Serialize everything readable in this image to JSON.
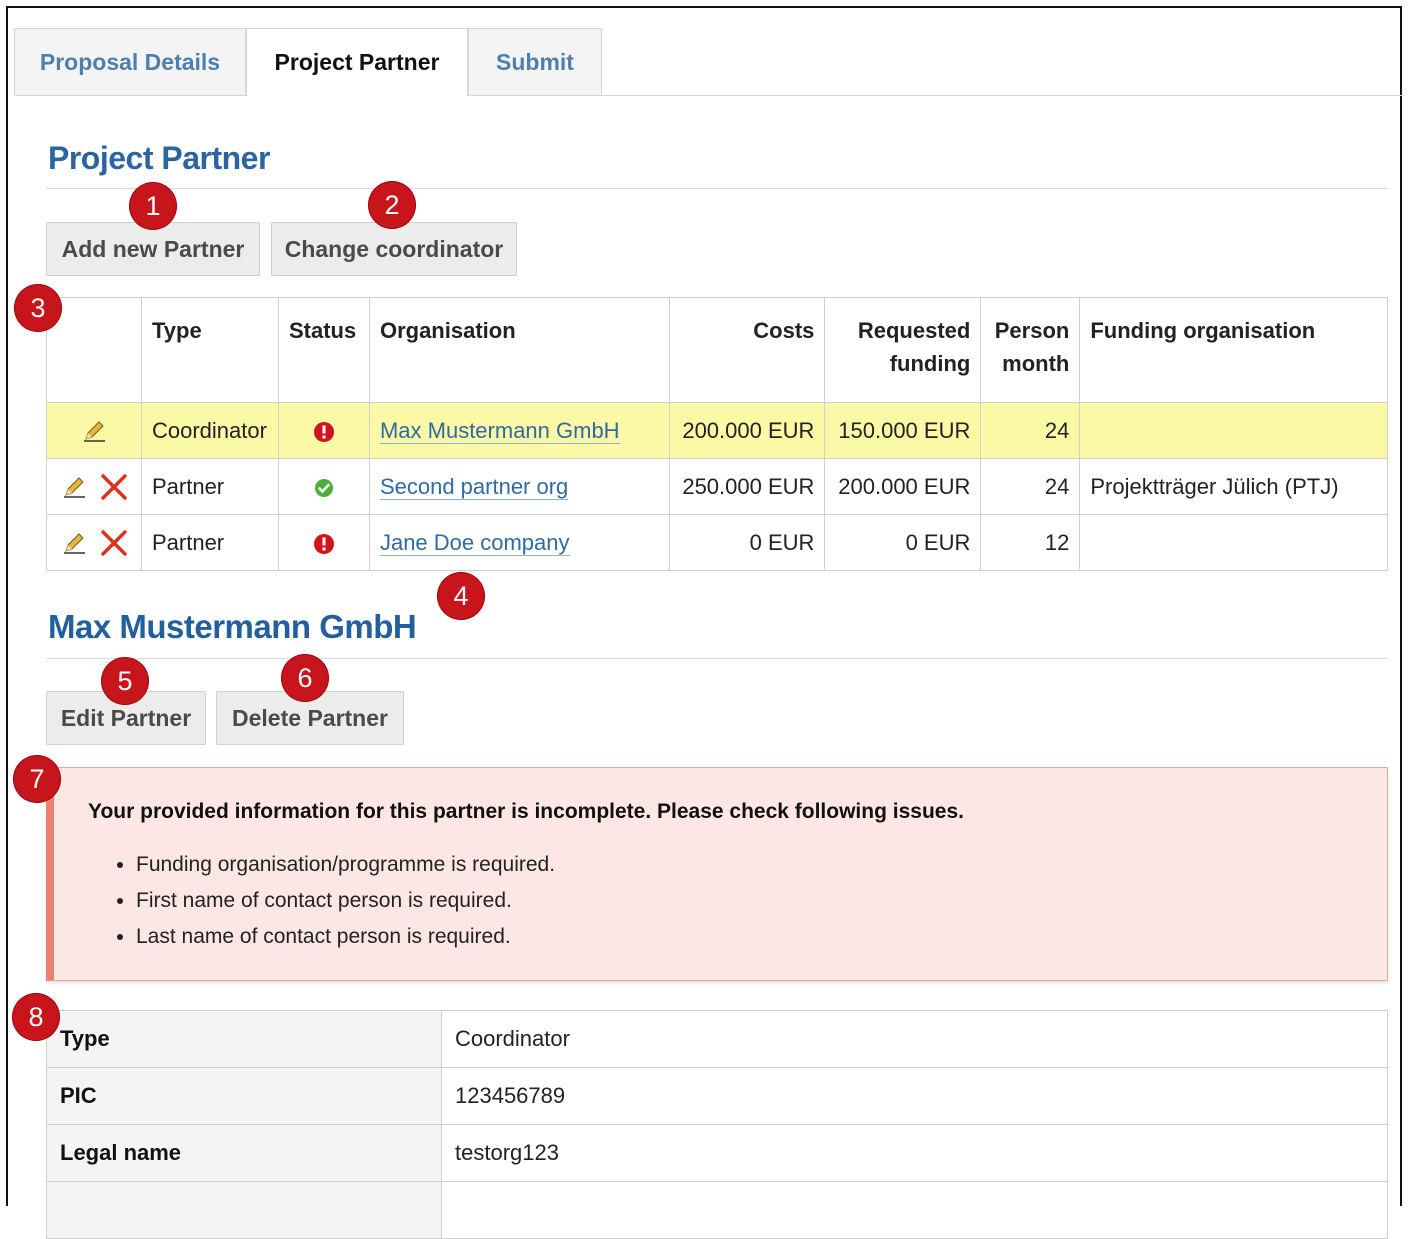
{
  "tabs": [
    {
      "label": "Proposal Details",
      "active": false
    },
    {
      "label": "Project Partner",
      "active": true
    },
    {
      "label": "Submit",
      "active": false
    }
  ],
  "section_title": "Project Partner",
  "buttons": {
    "add_partner": "Add new Partner",
    "change_coordinator": "Change coordinator"
  },
  "annotations": [
    "1",
    "2",
    "3",
    "4",
    "5",
    "6",
    "7",
    "8"
  ],
  "table": {
    "headers": {
      "type": "Type",
      "status": "Status",
      "organisation": "Organisation",
      "costs": "Costs",
      "requested_funding_line1": "Requested",
      "requested_funding_line2": "funding",
      "person_month_line1": "Person",
      "person_month_line2": "month",
      "funding_organisation": "Funding organisation"
    },
    "rows": [
      {
        "type": "Coordinator",
        "status": "incomplete",
        "organisation": "Max Mustermann GmbH",
        "costs": "200.000 EUR",
        "requested": "150.000 EUR",
        "person_month": "24",
        "funding_org": "",
        "deletable": false
      },
      {
        "type": "Partner",
        "status": "complete",
        "organisation": "Second partner org",
        "costs": "250.000 EUR",
        "requested": "200.000 EUR",
        "person_month": "24",
        "funding_org": "Projektträger Jülich (PTJ)",
        "deletable": true
      },
      {
        "type": "Partner",
        "status": "incomplete",
        "organisation": "Jane Doe company",
        "costs": "0 EUR",
        "requested": "0 EUR",
        "person_month": "12",
        "funding_org": "",
        "deletable": true
      }
    ]
  },
  "partner_detail": {
    "title": "Max Mustermann GmbH",
    "edit_button": "Edit Partner",
    "delete_button": "Delete Partner",
    "alert": {
      "title": "Your provided information for this partner is incomplete. Please check following issues.",
      "items": [
        "Funding organisation/programme is required.",
        "First name of contact person is required.",
        "Last name of contact person is required."
      ]
    },
    "fields": [
      {
        "label": "Type",
        "value": "Coordinator"
      },
      {
        "label": "PIC",
        "value": "123456789"
      },
      {
        "label": "Legal name",
        "value": "testorg123"
      }
    ]
  },
  "colors": {
    "accent": "#2b64a0",
    "link": "#2f6aa3",
    "highlight": "#fbf9a6",
    "badge": "#c8151b",
    "alert_bg": "#fce7e5",
    "alert_border": "#e9826f"
  }
}
